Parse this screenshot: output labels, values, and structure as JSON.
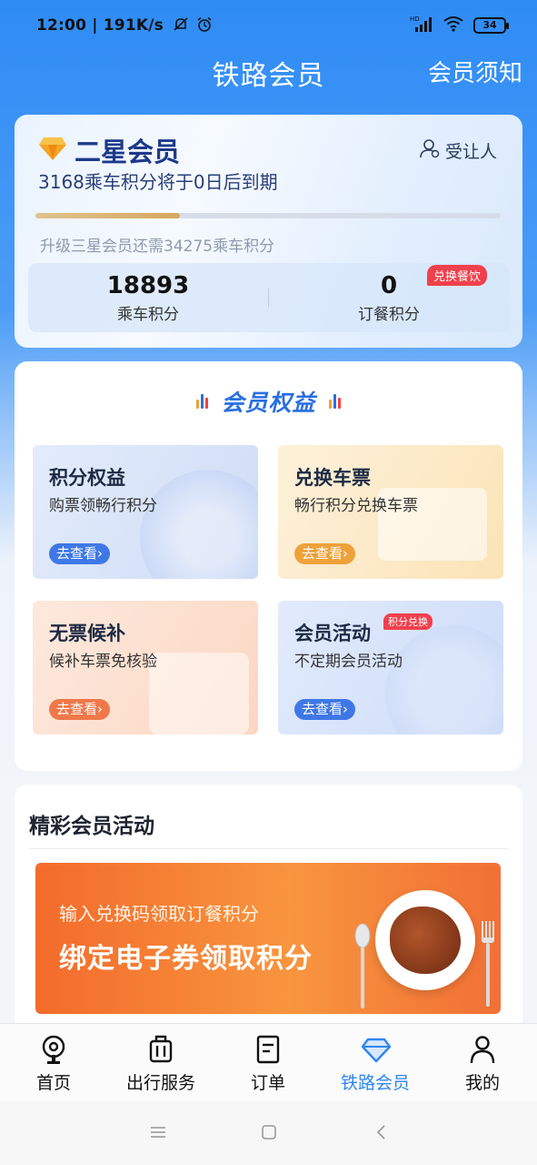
{
  "status_bar": {
    "time": "12:00",
    "network_speed": "191K/s",
    "battery": "34",
    "icons": [
      "mute-icon",
      "alarm-icon",
      "hd-signal-icon",
      "wifi-icon",
      "battery-icon"
    ]
  },
  "header": {
    "title": "铁路会员",
    "rules_link": "会员须知"
  },
  "member_card": {
    "level": "二星会员",
    "transferee": "受让人",
    "expire_text": "3168乘车积分将于0日后到期",
    "progress_fraction": 0.31,
    "upgrade_text": "升级三星会员还需34275乘车积分",
    "ride_points": {
      "value": "18893",
      "label": "乘车积分"
    },
    "meal_points": {
      "value": "0",
      "label": "订餐积分",
      "badge": "兑换餐饮"
    }
  },
  "benefits": {
    "title": "会员权益",
    "tiles": [
      {
        "title": "积分权益",
        "subtitle": "购票领畅行积分",
        "button": "去查看›"
      },
      {
        "title": "兑换车票",
        "subtitle": "畅行积分兑换车票",
        "button": "去查看›"
      },
      {
        "title": "无票候补",
        "subtitle": "候补车票免核验",
        "button": "去查看›"
      },
      {
        "title": "会员活动",
        "subtitle": "不定期会员活动",
        "button": "去查看›",
        "tag": "积分兑换"
      }
    ]
  },
  "activities": {
    "title": "精彩会员活动",
    "banner": {
      "line1": "输入兑换码领取订餐积分",
      "line2": "绑定电子券领取积分"
    }
  },
  "bottom_nav": {
    "items": [
      {
        "label": "首页",
        "icon": "home-train-icon"
      },
      {
        "label": "出行服务",
        "icon": "luggage-icon"
      },
      {
        "label": "订单",
        "icon": "order-icon"
      },
      {
        "label": "铁路会员",
        "icon": "diamond-icon",
        "active": true
      },
      {
        "label": "我的",
        "icon": "user-icon"
      }
    ]
  },
  "colors": {
    "primary_blue": "#2f86ee",
    "accent_red": "#f0404d",
    "gold": "#d6a75f"
  }
}
